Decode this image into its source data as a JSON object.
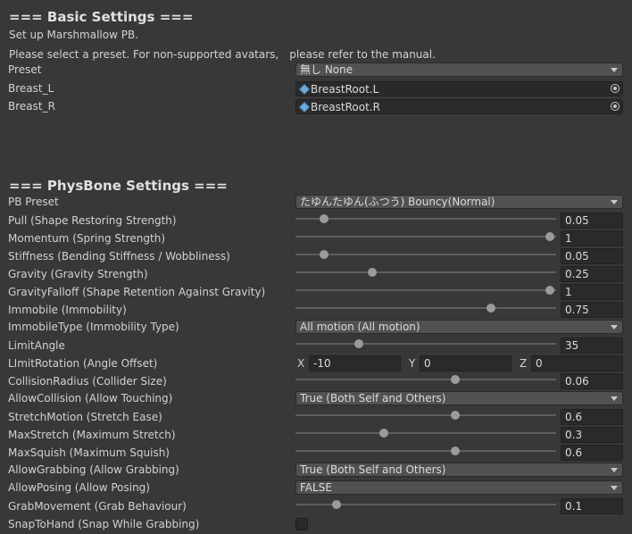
{
  "basic": {
    "title": "=== Basic Settings ===",
    "intro": "Set up Marshmallow PB.",
    "instruction": "Please select a preset. For non-supported avatars,　please refer to the manual.",
    "preset": {
      "label": "Preset",
      "value": "無し None"
    },
    "breast_l": {
      "label": "Breast_L",
      "value": "BreastRoot.L"
    },
    "breast_r": {
      "label": "Breast_R",
      "value": "BreastRoot.R"
    }
  },
  "physbone": {
    "title": "=== PhysBone Settings ===",
    "pb_preset": {
      "label": "PB Preset",
      "value": "たゆんたゆん(ふつう) Bouncy(Normal)"
    },
    "pull": {
      "label": "Pull (Shape Restoring Strength)",
      "value": "0.05",
      "fraction": 0.05
    },
    "momentum": {
      "label": "Momentum (Spring Strength)",
      "value": "1",
      "fraction": 1
    },
    "stiffness": {
      "label": "Stiffness (Bending Stiffness / Wobbliness)",
      "value": "0.05",
      "fraction": 0.05
    },
    "gravity": {
      "label": "Gravity (Gravity Strength)",
      "value": "0.25",
      "fraction": 0.25
    },
    "gravity_falloff": {
      "label": "GravityFalloff (Shape Retention Against Gravity)",
      "value": "1",
      "fraction": 1
    },
    "immobile": {
      "label": "Immobile (Immobility)",
      "value": "0.75",
      "fraction": 0.75
    },
    "immobile_type": {
      "label": "ImmobileType (Immobility Type)",
      "value": "All motion (All motion)"
    },
    "limit_angle": {
      "label": "LimitAngle",
      "value": "35",
      "fraction": 0.194
    },
    "limit_rotation": {
      "label": "LImitRotation (Angle Offset)",
      "x_label": "X",
      "x": "-10",
      "y_label": "Y",
      "y": "0",
      "z_label": "Z",
      "z": "0"
    },
    "collision_radius": {
      "label": "CollisionRadius (Collider Size)",
      "value": "0.06",
      "fraction": 0.6
    },
    "allow_collision": {
      "label": "AllowCollision (Allow Touching)",
      "value": "True (Both Self and Others)"
    },
    "stretch_motion": {
      "label": "StretchMotion (Stretch Ease)",
      "value": "0.6",
      "fraction": 0.6
    },
    "max_stretch": {
      "label": "MaxStretch (Maximum Stretch)",
      "value": "0.3",
      "fraction": 0.3
    },
    "max_squish": {
      "label": "MaxSquish (Maximum Squish)",
      "value": "0.6",
      "fraction": 0.6
    },
    "allow_grabbing": {
      "label": "AllowGrabbing (Allow Grabbing)",
      "value": "True (Both Self and Others)"
    },
    "allow_posing": {
      "label": "AllowPosing (Allow Posing)",
      "value": "FALSE"
    },
    "grab_movement": {
      "label": "GrabMovement (Grab Behaviour)",
      "value": "0.1",
      "fraction": 0.1
    },
    "snap_to_hand": {
      "label": "SnapToHand (Snap While Grabbing)",
      "checked": false
    }
  }
}
